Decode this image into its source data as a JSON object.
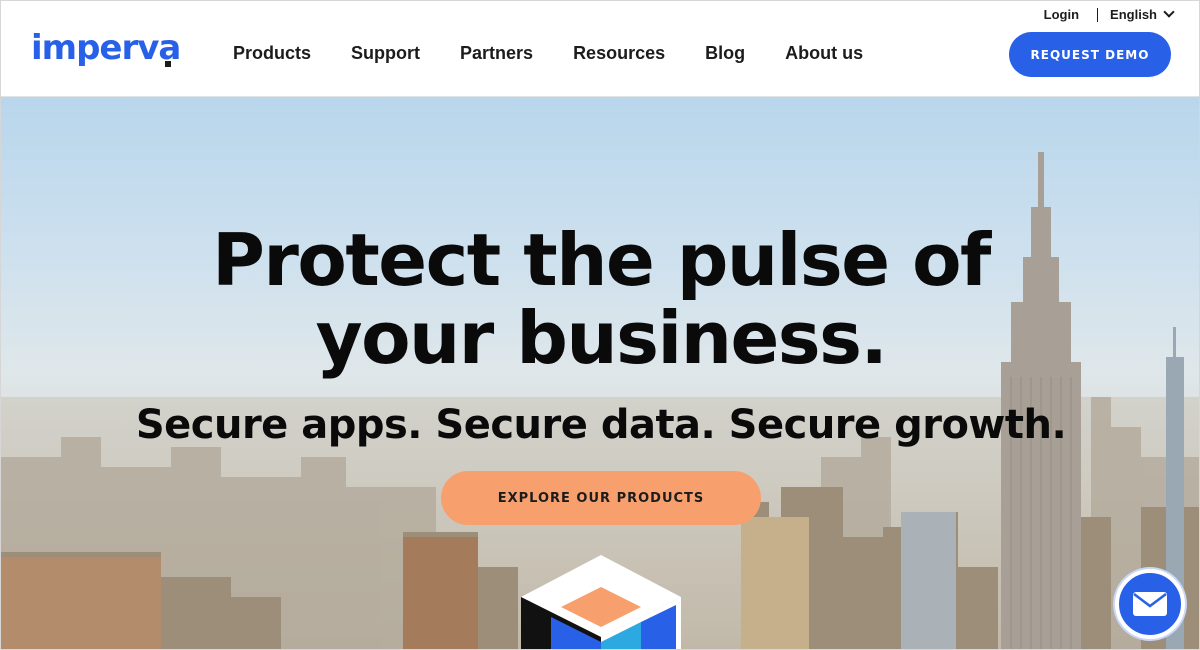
{
  "header": {
    "logo_text": "imperva",
    "nav": [
      {
        "label": "Products"
      },
      {
        "label": "Support"
      },
      {
        "label": "Partners"
      },
      {
        "label": "Resources"
      },
      {
        "label": "Blog"
      },
      {
        "label": "About us"
      }
    ],
    "utility": {
      "login_label": "Login",
      "language_label": "English"
    },
    "request_demo_label": "REQUEST DEMO"
  },
  "hero": {
    "title": "Protect the pulse of your business.",
    "subtitle": "Secure apps. Secure data. Secure growth.",
    "cta_label": "EXPLORE OUR PRODUCTS"
  },
  "chat": {
    "icon": "envelope-icon"
  },
  "colors": {
    "brand_blue": "#2861e8",
    "cta_orange": "#f7a06e",
    "text_dark": "#1c1c1c"
  }
}
